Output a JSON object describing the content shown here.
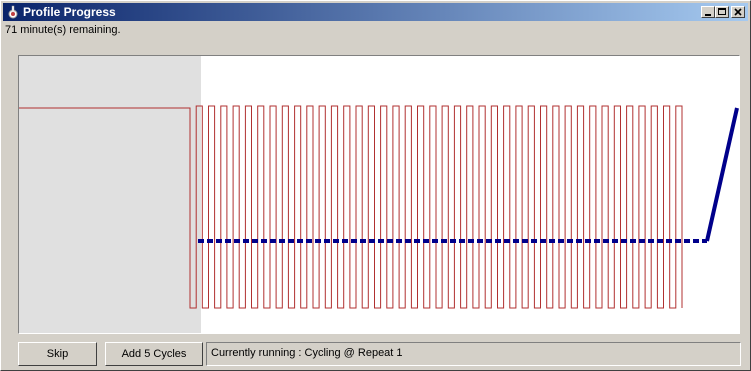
{
  "window": {
    "title": "Profile Progress",
    "icon": "thermometer-icon",
    "controls": [
      "minimize-icon",
      "maximize-icon",
      "close-icon"
    ]
  },
  "status_top": {
    "remaining": "71 minute(s) remaining."
  },
  "buttons": {
    "skip": "Skip",
    "add_cycles": "Add 5 Cycles"
  },
  "status_bar": {
    "text": "Currently running : Cycling @ Repeat 1"
  },
  "colors": {
    "profile_line": "#b03030",
    "progress_line": "#00008b",
    "elapsed_shade": "#e0e0e0",
    "titlebar": "#0a246a"
  },
  "progress": {
    "repeats_total": 40,
    "current_repeat": 1,
    "minutes_remaining": 71
  }
}
